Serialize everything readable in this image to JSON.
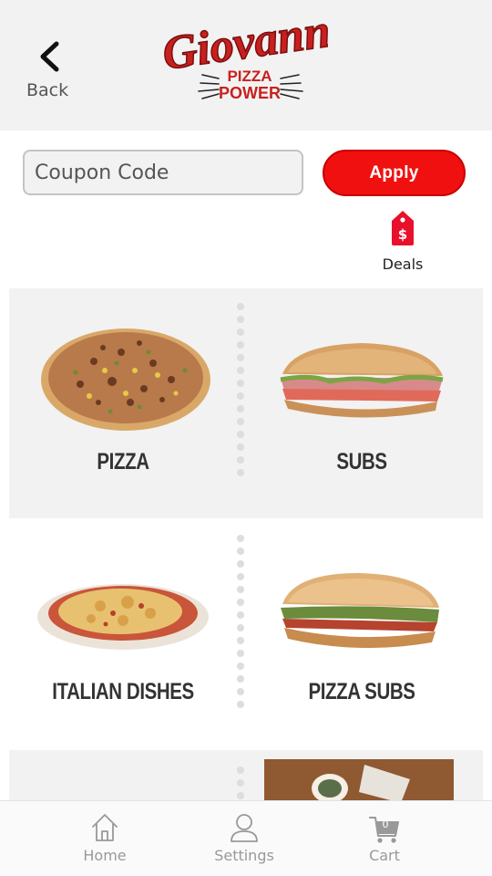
{
  "header": {
    "back_label": "Back",
    "logo": {
      "brand": "Giovanni's",
      "tagline_top": "PIZZA",
      "tagline_bottom": "POWER"
    }
  },
  "coupon": {
    "placeholder": "Coupon Code",
    "apply_label": "Apply"
  },
  "deals": {
    "label": "Deals",
    "icon": "price-tag-icon"
  },
  "categories": [
    {
      "label": "PIZZA",
      "icon": "pizza-image"
    },
    {
      "label": "SUBS",
      "icon": "sub-sandwich-image"
    },
    {
      "label": "ITALIAN DISHES",
      "icon": "baked-pasta-image"
    },
    {
      "label": "PIZZA SUBS",
      "icon": "pizza-sub-image"
    }
  ],
  "bottom_nav": {
    "items": [
      {
        "label": "Home",
        "icon": "home-icon"
      },
      {
        "label": "Settings",
        "icon": "user-icon"
      },
      {
        "label": "Cart",
        "icon": "cart-icon",
        "badge": "0"
      }
    ]
  },
  "colors": {
    "accent": "#f01010",
    "logo_red": "#c8201e",
    "header_bg": "#f2f2f2"
  }
}
